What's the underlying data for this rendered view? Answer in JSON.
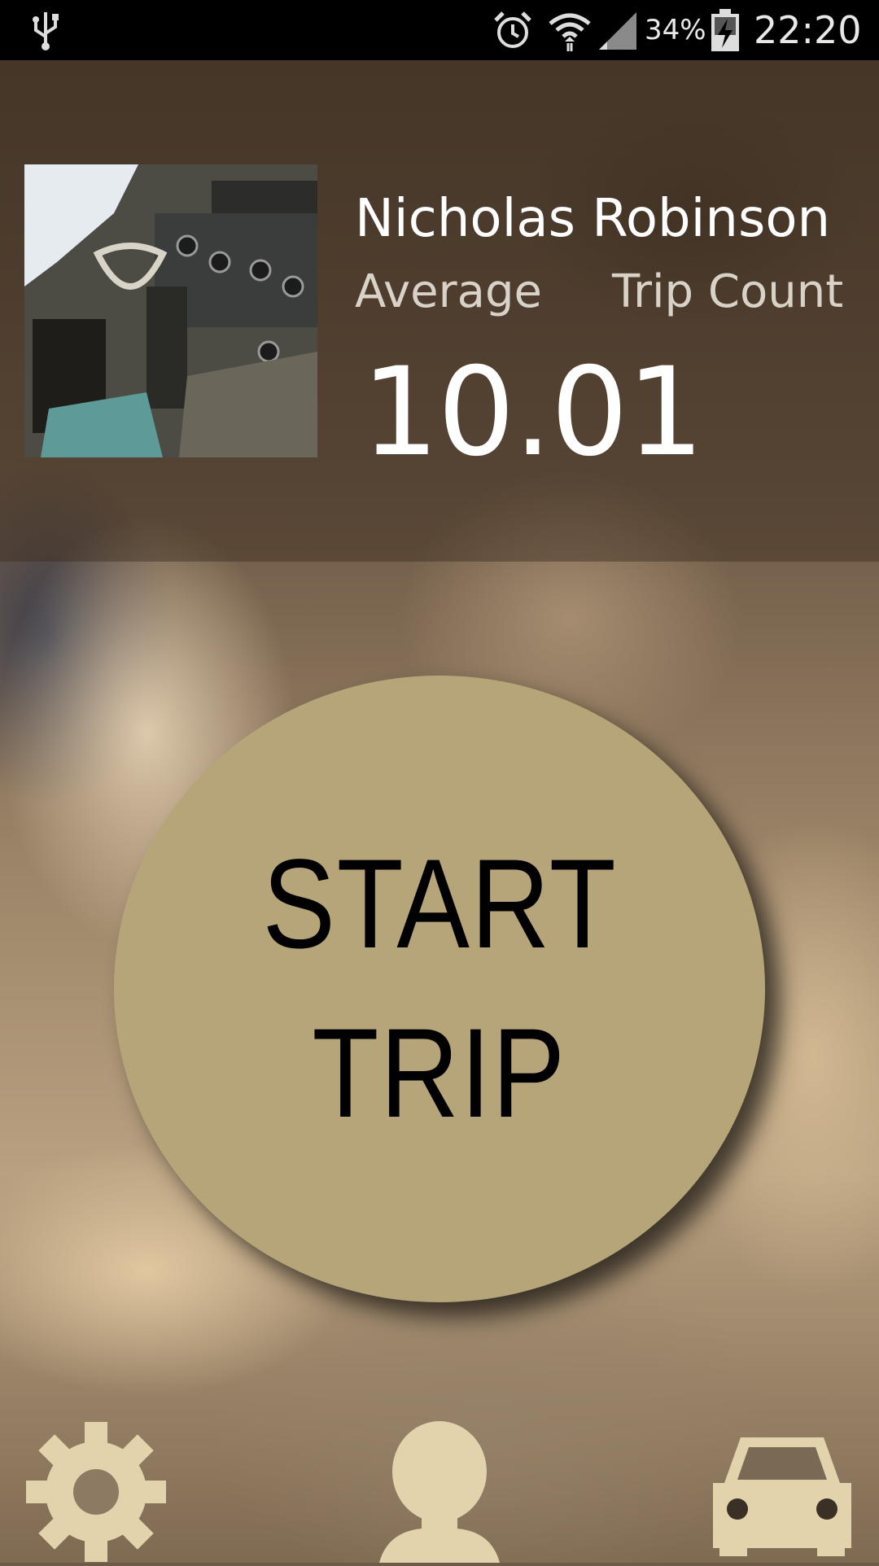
{
  "status_bar": {
    "battery_percent": "34%",
    "time": "22:20",
    "icons": [
      "usb-icon",
      "alarm-icon",
      "wifi-icon",
      "signal-icon",
      "battery-charging-icon"
    ]
  },
  "profile": {
    "avatar_icon": "cockpit-photo",
    "name": "Nicholas Robinson",
    "average_label": "Average",
    "trip_count_label": "Trip Count",
    "average_value": "10.01"
  },
  "start_button": {
    "line1": "START",
    "line2": "TRIP"
  },
  "bottom_nav": {
    "items": [
      "settings-gear-icon",
      "profile-person-icon",
      "car-icon"
    ]
  },
  "colors": {
    "accent": "#b7a57a",
    "nav_icon": "#e3d3ad",
    "status_bar": "#000000"
  }
}
